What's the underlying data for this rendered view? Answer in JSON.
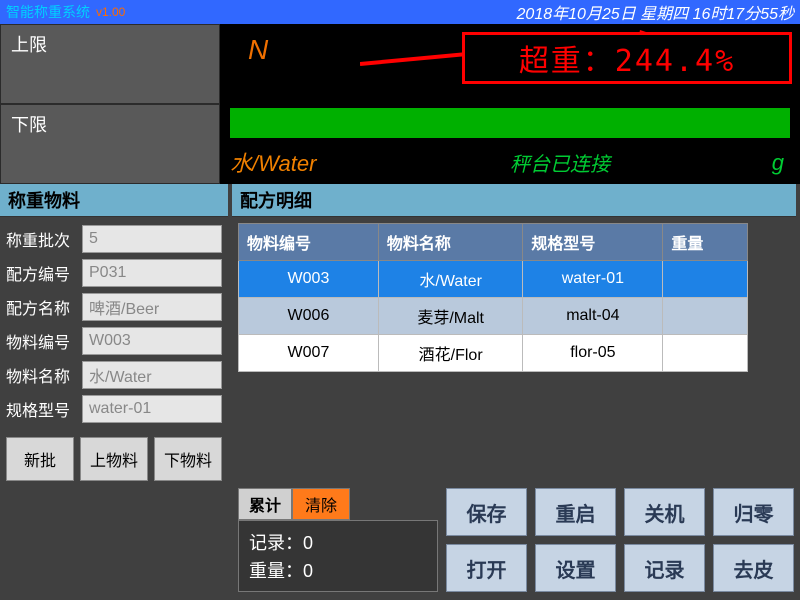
{
  "titlebar": {
    "title": "智能称重系统",
    "version": "v1.00",
    "datetime": "2018年10月25日  星期四  16时17分55秒"
  },
  "limits": {
    "upper_label": "上限",
    "lower_label": "下限"
  },
  "readout": {
    "indicator": "N",
    "overweight": "超重：244.4%",
    "material": "水/Water",
    "status": "秤台已连接",
    "unit": "g"
  },
  "left": {
    "header": "称重物料",
    "fields": {
      "batch_label": "称重批次",
      "batch_value": "5",
      "recipe_no_label": "配方编号",
      "recipe_no_value": "P031",
      "recipe_name_label": "配方名称",
      "recipe_name_value": "啤酒/Beer",
      "material_no_label": "物料编号",
      "material_no_value": "W003",
      "material_name_label": "物料名称",
      "material_name_value": "水/Water",
      "spec_label": "规格型号",
      "spec_value": "water-01"
    },
    "buttons": {
      "new_batch": "新批",
      "prev": "上物料",
      "next": "下物料"
    }
  },
  "recipe": {
    "header": "配方明细",
    "columns": {
      "c1": "物料编号",
      "c2": "物料名称",
      "c3": "规格型号",
      "c4": "重量"
    },
    "rows": [
      {
        "no": "W003",
        "name": "水/Water",
        "spec": "water-01",
        "wt": ""
      },
      {
        "no": "W006",
        "name": "麦芽/Malt",
        "spec": "malt-04",
        "wt": ""
      },
      {
        "no": "W007",
        "name": "酒花/Flor",
        "spec": "flor-05",
        "wt": ""
      }
    ]
  },
  "totals": {
    "label": "累计",
    "clear": "清除",
    "records_label": "记录",
    "records_value": "0",
    "weight_label": "重量",
    "weight_value": "0"
  },
  "buttons": {
    "save": "保存",
    "reboot": "重启",
    "shutdown": "关机",
    "zero": "归零",
    "open": "打开",
    "settings": "设置",
    "records": "记录",
    "tare": "去皮"
  }
}
